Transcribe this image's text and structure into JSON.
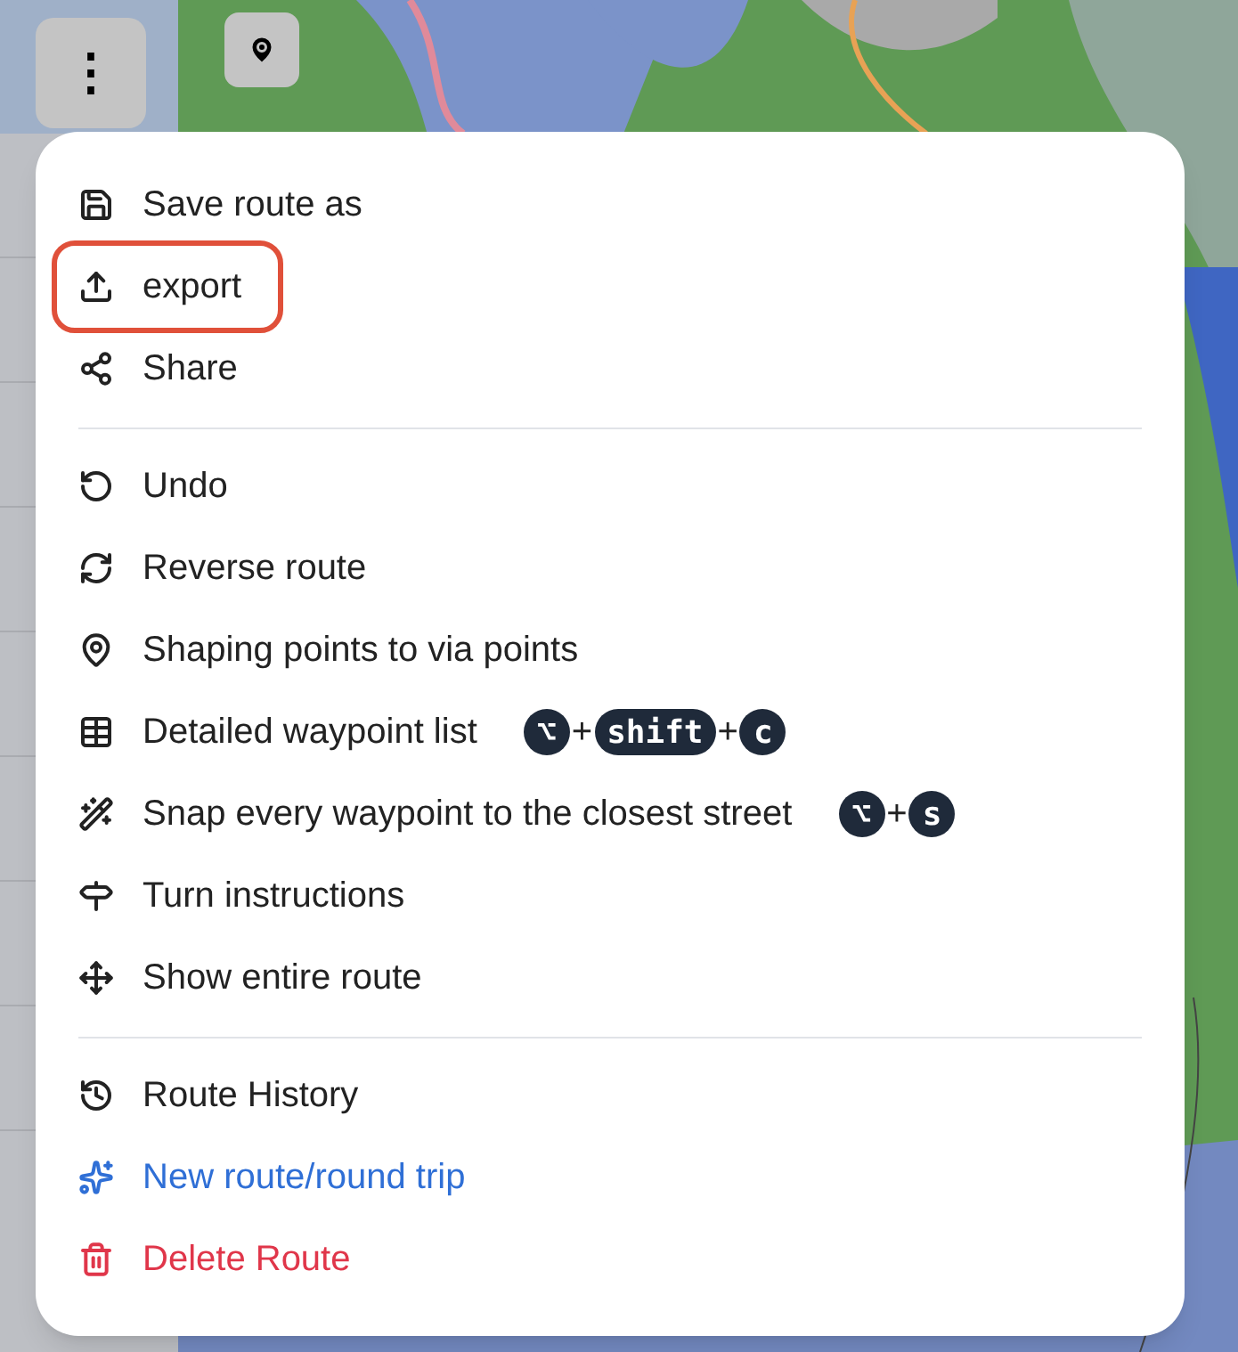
{
  "toolbar": {
    "menu_button": {
      "label": "⋮"
    }
  },
  "menu": {
    "groups": [
      {
        "items": [
          {
            "label": "Save route as",
            "kind": "default",
            "highlighted": false
          },
          {
            "label": "export",
            "kind": "default",
            "highlighted": true
          },
          {
            "label": "Share",
            "kind": "default",
            "highlighted": false
          }
        ]
      },
      {
        "items": [
          {
            "label": "Undo",
            "kind": "default",
            "highlighted": false
          },
          {
            "label": "Reverse route",
            "kind": "default",
            "highlighted": false
          },
          {
            "label": "Shaping points to via points",
            "kind": "default",
            "highlighted": false
          },
          {
            "label": "Detailed waypoint list",
            "kind": "default",
            "highlighted": false,
            "shortcut": [
              "⌥",
              "+",
              "shift",
              "+",
              "c"
            ]
          },
          {
            "label": "Snap every waypoint to the closest street",
            "kind": "default",
            "highlighted": false,
            "shortcut": [
              "⌥",
              "+",
              "s"
            ]
          },
          {
            "label": "Turn instructions",
            "kind": "default",
            "highlighted": false
          },
          {
            "label": "Show entire route",
            "kind": "default",
            "highlighted": false
          }
        ]
      },
      {
        "items": [
          {
            "label": "Route History",
            "kind": "default",
            "highlighted": false
          },
          {
            "label": "New route/round trip",
            "kind": "primary",
            "highlighted": false
          },
          {
            "label": "Delete Route",
            "kind": "danger",
            "highlighted": false
          }
        ]
      }
    ]
  }
}
